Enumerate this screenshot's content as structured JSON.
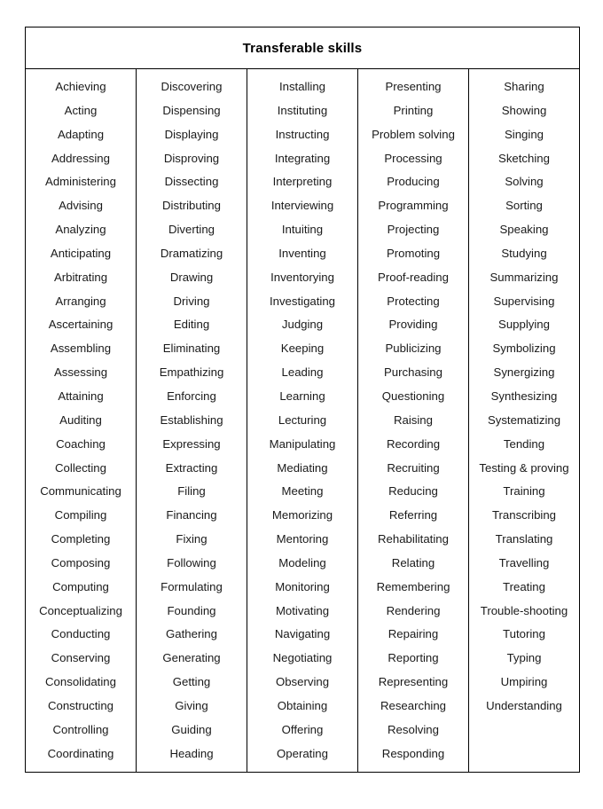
{
  "document": {
    "title": "Transferable skills"
  },
  "table": {
    "title": "Transferable skills",
    "column_count": 5,
    "columns": [
      {
        "name": "column-a",
        "items": [
          "Achieving",
          "Acting",
          "Adapting",
          "Addressing",
          "Administering",
          "Advising",
          "Analyzing",
          "Anticipating",
          "Arbitrating",
          "Arranging",
          "Ascertaining",
          "Assembling",
          "Assessing",
          "Attaining",
          "Auditing",
          "Coaching",
          "Collecting",
          "Communicating",
          "Compiling",
          "Completing",
          "Composing",
          "Computing",
          "Conceptualizing",
          "Conducting",
          "Conserving",
          "Consolidating",
          "Constructing",
          "Controlling",
          "Coordinating"
        ]
      },
      {
        "name": "column-d",
        "items": [
          "Discovering",
          "Dispensing",
          "Displaying",
          "Disproving",
          "Dissecting",
          "Distributing",
          "Diverting",
          "Dramatizing",
          "Drawing",
          "Driving",
          "Editing",
          "Eliminating",
          "Empathizing",
          "Enforcing",
          "Establishing",
          "Expressing",
          "Extracting",
          "Filing",
          "Financing",
          "Fixing",
          "Following",
          "Formulating",
          "Founding",
          "Gathering",
          "Generating",
          "Getting",
          "Giving",
          "Guiding",
          "Heading"
        ]
      },
      {
        "name": "column-i",
        "items": [
          "Installing",
          "Instituting",
          "Instructing",
          "Integrating",
          "Interpreting",
          "Interviewing",
          "Intuiting",
          "Inventing",
          "Inventorying",
          "Investigating",
          "Judging",
          "Keeping",
          "Leading",
          "Learning",
          "Lecturing",
          "Manipulating",
          "Mediating",
          "Meeting",
          "Memorizing",
          "Mentoring",
          "Modeling",
          "Monitoring",
          "Motivating",
          "Navigating",
          "Negotiating",
          "Observing",
          "Obtaining",
          "Offering",
          "Operating"
        ]
      },
      {
        "name": "column-p",
        "items": [
          "Presenting",
          "Printing",
          "Problem solving",
          "Processing",
          "Producing",
          "Programming",
          "Projecting",
          "Promoting",
          "Proof-reading",
          "Protecting",
          "Providing",
          "Publicizing",
          "Purchasing",
          "Questioning",
          "Raising",
          "Recording",
          "Recruiting",
          "Reducing",
          "Referring",
          "Rehabilitating",
          "Relating",
          "Remembering",
          "Rendering",
          "Repairing",
          "Reporting",
          "Representing",
          "Researching",
          "Resolving",
          "Responding"
        ]
      },
      {
        "name": "column-s",
        "items": [
          "Sharing",
          "Showing",
          "Singing",
          "Sketching",
          "Solving",
          "Sorting",
          "Speaking",
          "Studying",
          "Summarizing",
          "Supervising",
          "Supplying",
          "Symbolizing",
          "Synergizing",
          "Synthesizing",
          "Systematizing",
          "Tending",
          "Testing & proving",
          "Training",
          "Transcribing",
          "Translating",
          "Travelling",
          "Treating",
          "Trouble-shooting",
          "Tutoring",
          "Typing",
          "Umpiring",
          "Understanding"
        ]
      }
    ]
  }
}
